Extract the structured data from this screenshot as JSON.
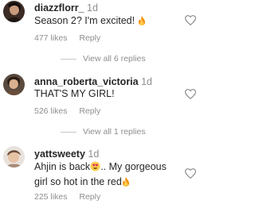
{
  "comments": [
    {
      "username": "diazzflorr_",
      "age": "1d",
      "text": "Season 2? I'm excited! ",
      "likes": "477 likes",
      "reply": "Reply",
      "view_replies": "View all 6 replies",
      "avatar_icon": "profile-photo"
    },
    {
      "username": "anna_roberta_victoria",
      "age": "1d",
      "text": "THAT'S MY GIRL!",
      "likes": "526 likes",
      "reply": "Reply",
      "view_replies": "View all 1 replies",
      "avatar_icon": "profile-photo"
    },
    {
      "username": "yattsweety",
      "age": "1d",
      "text_part1": "Ahjin is back",
      "text_part2": ".. My gorgeous girl so hot in the red",
      "likes": "225 likes",
      "reply": "Reply",
      "avatar_icon": "profile-photo"
    }
  ],
  "colors": {
    "text": "#262626",
    "secondary": "#8e8e8e",
    "divider": "#c7c7c7"
  }
}
